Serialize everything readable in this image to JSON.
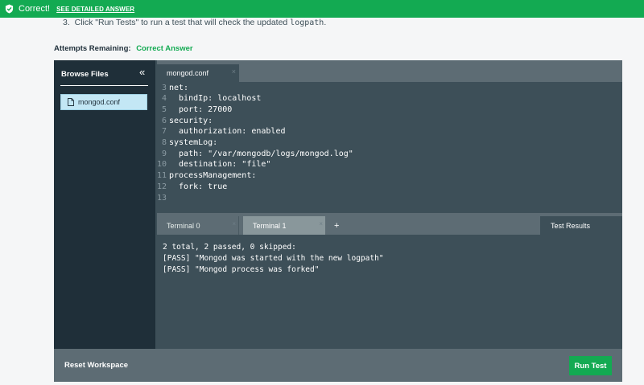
{
  "banner": {
    "status": "Correct!",
    "detail_link": "SEE DETAILED ANSWER",
    "color": "#13aa52"
  },
  "step": {
    "number": "3.",
    "text_before": "Click \"Run Tests\" to run a test that will check the updated ",
    "code": "logpath",
    "text_after": "."
  },
  "attempts": {
    "label": "Attempts Remaining:",
    "value": "Correct Answer"
  },
  "sidebar": {
    "title": "Browse Files",
    "collapse_icon": "«",
    "files": [
      {
        "name": "mongod.conf"
      }
    ]
  },
  "editor": {
    "tab_label": "mongod.conf",
    "tab_close": "×",
    "lines": [
      {
        "num": "3",
        "text": "net:"
      },
      {
        "num": "4",
        "text": "  bindIp: localhost"
      },
      {
        "num": "5",
        "text": "  port: 27000"
      },
      {
        "num": "6",
        "text": "security:"
      },
      {
        "num": "7",
        "text": "  authorization: enabled"
      },
      {
        "num": "8",
        "text": "systemLog:"
      },
      {
        "num": "9",
        "text": "  path: \"/var/mongodb/logs/mongod.log\""
      },
      {
        "num": "10",
        "text": "  destination: \"file\""
      },
      {
        "num": "11",
        "text": "processManagement:"
      },
      {
        "num": "12",
        "text": "  fork: true"
      },
      {
        "num": "13",
        "text": ""
      }
    ]
  },
  "terminal": {
    "tabs": [
      {
        "label": "Terminal 0",
        "close": "×"
      },
      {
        "label": "Terminal 1",
        "close": "×"
      }
    ],
    "add_label": "+",
    "results_tab": "Test Results",
    "output": "2 total, 2 passed, 0 skipped:\n[PASS] \"Mongod was started with the new logpath\"\n[PASS] \"Mongod process was forked\""
  },
  "footer": {
    "reset_label": "Reset Workspace",
    "run_label": "Run Test"
  }
}
